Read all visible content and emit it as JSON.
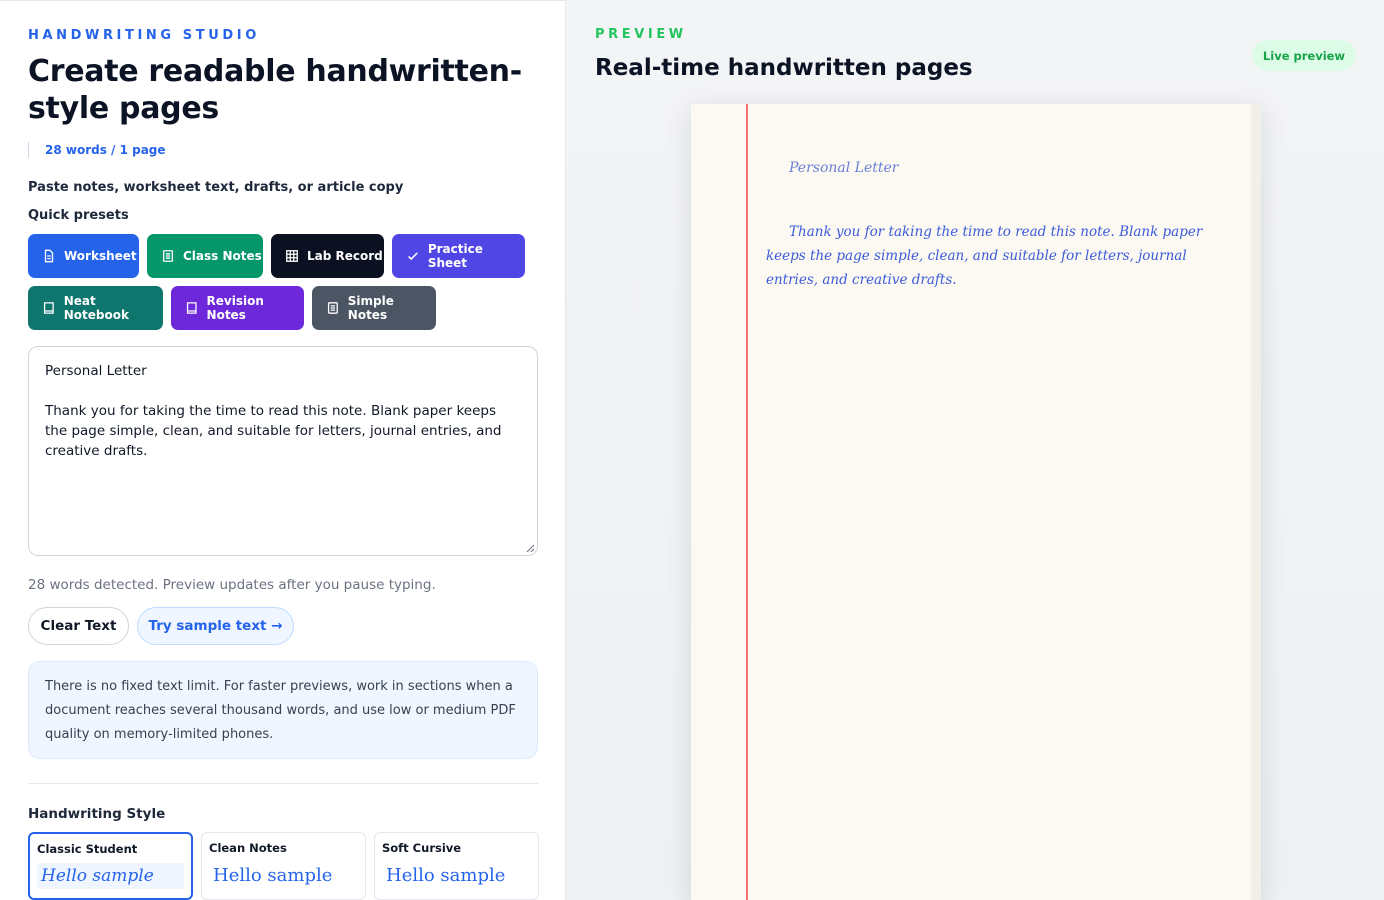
{
  "editor": {
    "eyebrow": "HANDWRITING STUDIO",
    "title": "Create readable handwritten-style pages",
    "count_badge": "28 words / 1 page",
    "paste_label": "Paste notes, worksheet text, drafts, or article copy",
    "presets_label": "Quick presets",
    "presets": [
      {
        "label": "Worksheet",
        "icon": "document-icon",
        "color": "#2563eb"
      },
      {
        "label": "Class Notes",
        "icon": "notes-icon",
        "color": "#059669"
      },
      {
        "label": "Lab Record",
        "icon": "grid-icon",
        "color": "#0b1120"
      },
      {
        "label": "Practice Sheet",
        "icon": "check-icon",
        "color": "#4f46e5"
      },
      {
        "label": "Neat Notebook",
        "icon": "notebook-icon",
        "color": "#0f766e"
      },
      {
        "label": "Revision Notes",
        "icon": "notebook-icon",
        "color": "#6d28d9"
      },
      {
        "label": "Simple Notes",
        "icon": "notes-icon",
        "color": "#4b5563"
      }
    ],
    "text_title": "Personal Letter",
    "text_body": "Thank you for taking the time to read this note. Blank paper keeps the page simple, clean, and suitable for letters, journal entries, and creative drafts.",
    "hint": "28 words detected. Preview updates after you pause typing.",
    "clear_label": "Clear Text",
    "sample_label": "Try sample text →",
    "info": "There is no fixed text limit. For faster previews, work in sections when a document reaches several thousand words, and use low or medium PDF quality on memory-limited phones.",
    "style_label": "Handwriting Style",
    "styles": [
      {
        "name": "Classic Student",
        "sample": "Hello sample",
        "selected": true
      },
      {
        "name": "Clean Notes",
        "sample": "Hello sample",
        "selected": false
      },
      {
        "name": "Soft Cursive",
        "sample": "Hello sample",
        "selected": false
      }
    ]
  },
  "preview": {
    "eyebrow": "PREVIEW",
    "title": "Real-time handwritten pages",
    "badge": "Live preview",
    "page_title": "Personal Letter",
    "page_body": "Thank you for taking the time to read this note. Blank paper keeps the page simple, clean, and suitable for letters, journal entries, and creative drafts."
  },
  "colors": {
    "accent": "#2563eb",
    "preview_accent": "#22c55e",
    "margin_line": "#f87171",
    "ink": "#3b5bdb"
  }
}
